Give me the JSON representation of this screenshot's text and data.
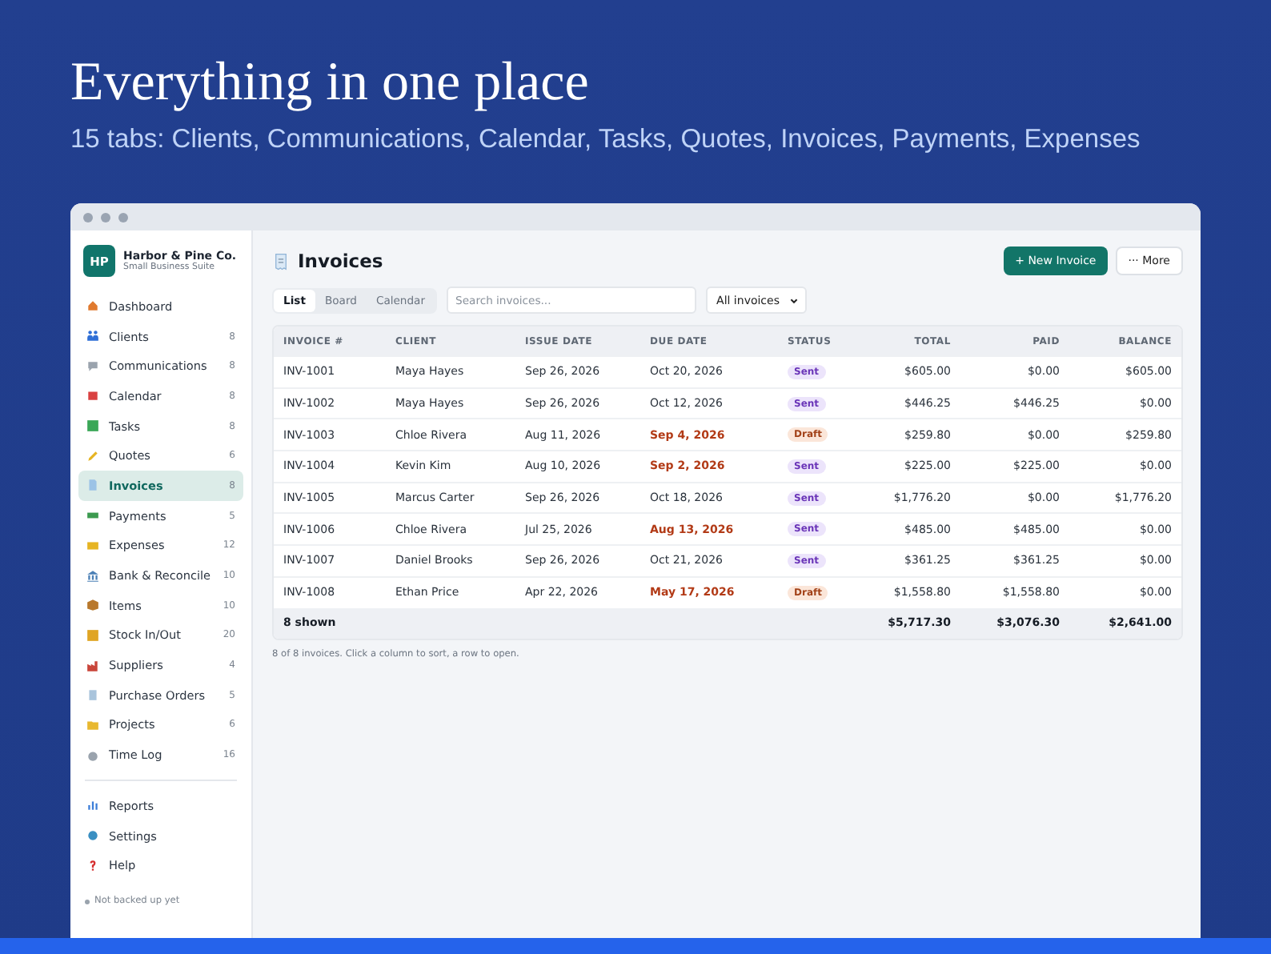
{
  "hero": {
    "title": "Everything in one place",
    "subtitle": "15 tabs: Clients, Communications, Calendar, Tasks, Quotes, Invoices, Payments, Expenses"
  },
  "brand": {
    "initials": "HP",
    "name": "Harbor & Pine Co.",
    "subtitle": "Small Business Suite"
  },
  "nav": [
    {
      "label": "Dashboard",
      "selected": false
    },
    {
      "label": "Clients",
      "count": "8",
      "selected": false
    },
    {
      "label": "Communications",
      "count": "8",
      "selected": false
    },
    {
      "label": "Calendar",
      "count": "8",
      "selected": false
    },
    {
      "label": "Tasks",
      "count": "8",
      "selected": false
    },
    {
      "label": "Quotes",
      "count": "6",
      "selected": false
    },
    {
      "label": "Invoices",
      "count": "8",
      "selected": true
    },
    {
      "label": "Payments",
      "count": "5",
      "selected": false
    },
    {
      "label": "Expenses",
      "count": "12",
      "selected": false
    },
    {
      "label": "Bank & Reconcile",
      "count": "10",
      "selected": false
    },
    {
      "label": "Items",
      "count": "10",
      "selected": false
    },
    {
      "label": "Stock In/Out",
      "count": "20",
      "selected": false
    },
    {
      "label": "Suppliers",
      "count": "4",
      "selected": false
    },
    {
      "label": "Purchase Orders",
      "count": "5",
      "selected": false
    },
    {
      "label": "Projects",
      "count": "6",
      "selected": false
    },
    {
      "label": "Time Log",
      "count": "16",
      "selected": false
    }
  ],
  "nav_footer": [
    {
      "label": "Reports",
      "selected": false
    },
    {
      "label": "Settings",
      "selected": false
    },
    {
      "label": "Help",
      "selected": false
    }
  ],
  "backup_status": "Not backed up yet",
  "page_title": "Invoices",
  "new_button": "+ New Invoice",
  "more_button": "··· More",
  "view_tabs": [
    {
      "label": "List",
      "selected": true
    },
    {
      "label": "Board",
      "selected": false
    },
    {
      "label": "Calendar",
      "selected": false
    }
  ],
  "search": {
    "placeholder": "Search invoices..."
  },
  "filter": {
    "value": "All invoices"
  },
  "table": {
    "columns": [
      "INVOICE #",
      "CLIENT",
      "ISSUE DATE",
      "DUE DATE",
      "STATUS",
      "TOTAL",
      "PAID",
      "BALANCE"
    ],
    "rows": [
      {
        "invoice": "INV-1001",
        "client": "Maya Hayes",
        "issue": "Sep 26, 2026",
        "due": "Oct 20, 2026",
        "overdue": false,
        "status": "Sent",
        "kind": "sent",
        "total": "$605.00",
        "paid": "$0.00",
        "balance": "$605.00"
      },
      {
        "invoice": "INV-1002",
        "client": "Maya Hayes",
        "issue": "Sep 26, 2026",
        "due": "Oct 12, 2026",
        "overdue": false,
        "status": "Sent",
        "kind": "sent",
        "total": "$446.25",
        "paid": "$446.25",
        "balance": "$0.00"
      },
      {
        "invoice": "INV-1003",
        "client": "Chloe Rivera",
        "issue": "Aug 11, 2026",
        "due": "Sep 4, 2026",
        "overdue": true,
        "status": "Draft",
        "kind": "draft",
        "total": "$259.80",
        "paid": "$0.00",
        "balance": "$259.80"
      },
      {
        "invoice": "INV-1004",
        "client": "Kevin Kim",
        "issue": "Aug 10, 2026",
        "due": "Sep 2, 2026",
        "overdue": true,
        "status": "Sent",
        "kind": "sent",
        "total": "$225.00",
        "paid": "$225.00",
        "balance": "$0.00"
      },
      {
        "invoice": "INV-1005",
        "client": "Marcus Carter",
        "issue": "Sep 26, 2026",
        "due": "Oct 18, 2026",
        "overdue": false,
        "status": "Sent",
        "kind": "sent",
        "total": "$1,776.20",
        "paid": "$0.00",
        "balance": "$1,776.20"
      },
      {
        "invoice": "INV-1006",
        "client": "Chloe Rivera",
        "issue": "Jul 25, 2026",
        "due": "Aug 13, 2026",
        "overdue": true,
        "status": "Sent",
        "kind": "sent",
        "total": "$485.00",
        "paid": "$485.00",
        "balance": "$0.00"
      },
      {
        "invoice": "INV-1007",
        "client": "Daniel Brooks",
        "issue": "Sep 26, 2026",
        "due": "Oct 21, 2026",
        "overdue": false,
        "status": "Sent",
        "kind": "sent",
        "total": "$361.25",
        "paid": "$361.25",
        "balance": "$0.00"
      },
      {
        "invoice": "INV-1008",
        "client": "Ethan Price",
        "issue": "Apr 22, 2026",
        "due": "May 17, 2026",
        "overdue": true,
        "status": "Draft",
        "kind": "draft",
        "total": "$1,558.80",
        "paid": "$1,558.80",
        "balance": "$0.00"
      }
    ],
    "footer": {
      "label": "8 shown",
      "total": "$5,717.30",
      "paid": "$3,076.30",
      "balance": "$2,641.00"
    }
  },
  "note": "8 of 8 invoices. Click a column to sort, a row to open."
}
